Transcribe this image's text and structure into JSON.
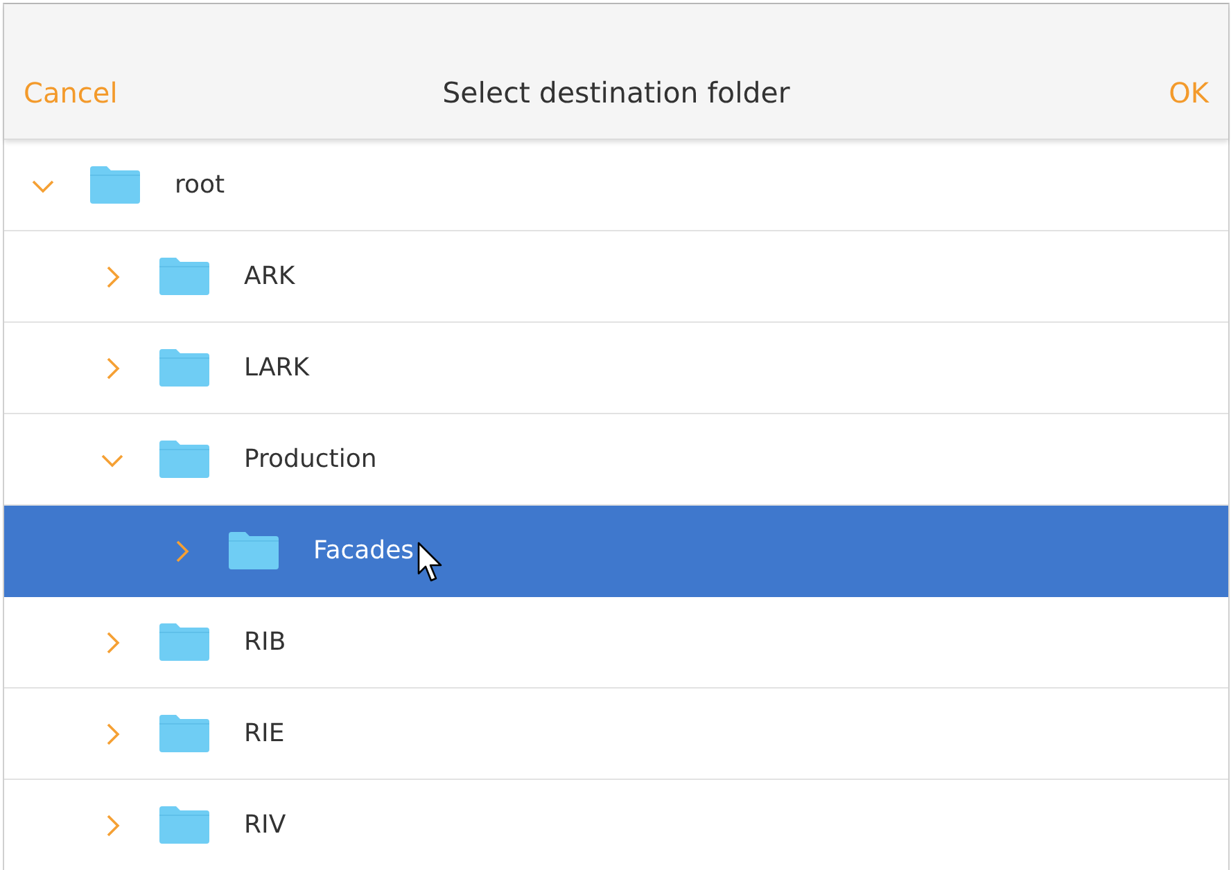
{
  "header": {
    "cancel": "Cancel",
    "title": "Select destination folder",
    "ok": "OK"
  },
  "tree": [
    {
      "label": "root",
      "expanded": true,
      "selected": false,
      "children": [
        {
          "label": "ARK",
          "expanded": false,
          "selected": false
        },
        {
          "label": "LARK",
          "expanded": false,
          "selected": false
        },
        {
          "label": "Production",
          "expanded": true,
          "selected": false,
          "children": [
            {
              "label": "Facades",
              "expanded": false,
              "selected": true
            }
          ]
        },
        {
          "label": "RIB",
          "expanded": false,
          "selected": false
        },
        {
          "label": "RIE",
          "expanded": false,
          "selected": false
        },
        {
          "label": "RIV",
          "expanded": false,
          "selected": false
        }
      ]
    }
  ]
}
